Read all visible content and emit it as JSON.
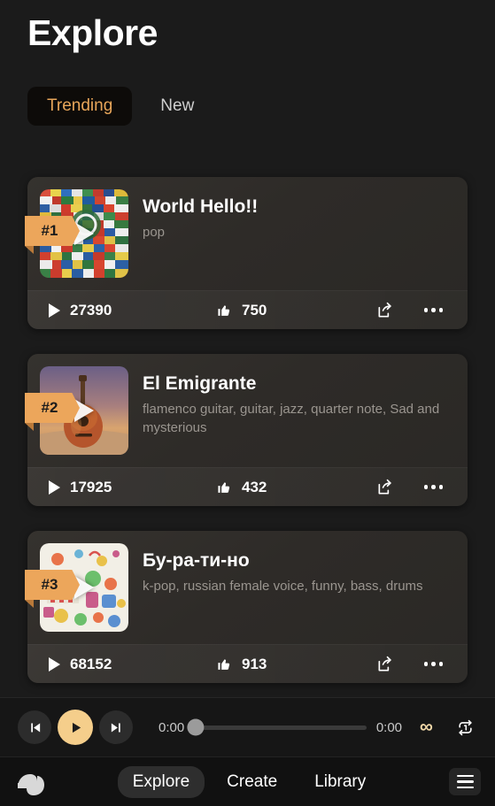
{
  "header": {
    "title": "Explore",
    "tabs": [
      {
        "label": "Trending",
        "active": true
      },
      {
        "label": "New",
        "active": false
      }
    ]
  },
  "theme": {
    "background": "#1b1b1b",
    "accent": "#e8a65a",
    "badge_orange": "#eca65b",
    "card_background": "#322f2c",
    "player_accent": "#f5ce8b",
    "text_primary": "#ffffff",
    "text_secondary": "#9a958f"
  },
  "tracks": [
    {
      "rank": "#1",
      "title": "World Hello!!",
      "tags": "pop",
      "plays": "27390",
      "likes": "750",
      "thumb": "world-flags-collage"
    },
    {
      "rank": "#2",
      "title": "El Emigrante",
      "tags": "flamenco guitar, guitar, jazz, quarter note,  Sad and mysterious",
      "plays": "17925",
      "likes": "432",
      "thumb": "acoustic-guitar-sunset"
    },
    {
      "rank": "#3",
      "title": "Бу-ра-ти-но",
      "tags": "k-pop, russian female voice, funny, bass, drums",
      "plays": "68152",
      "likes": "913",
      "thumb": "colorful-carnival-illustration"
    }
  ],
  "player": {
    "current_time": "0:00",
    "total_time": "0:00",
    "progress_percent": 0,
    "prev_icon": "skip-previous-icon",
    "play_icon": "play-icon",
    "next_icon": "skip-next-icon",
    "infinity_icon": "∞",
    "repeat_icon": "repeat-one-icon"
  },
  "bottom_nav": {
    "logo_icon": "sine-wave-logo",
    "links": [
      {
        "label": "Explore",
        "active": true
      },
      {
        "label": "Create",
        "active": false
      },
      {
        "label": "Library",
        "active": false
      }
    ],
    "menu_icon": "hamburger-menu-icon"
  },
  "stat_icons": {
    "play": "play-icon",
    "like": "thumbs-up-icon",
    "share": "share-icon",
    "more": "more-options-icon"
  }
}
